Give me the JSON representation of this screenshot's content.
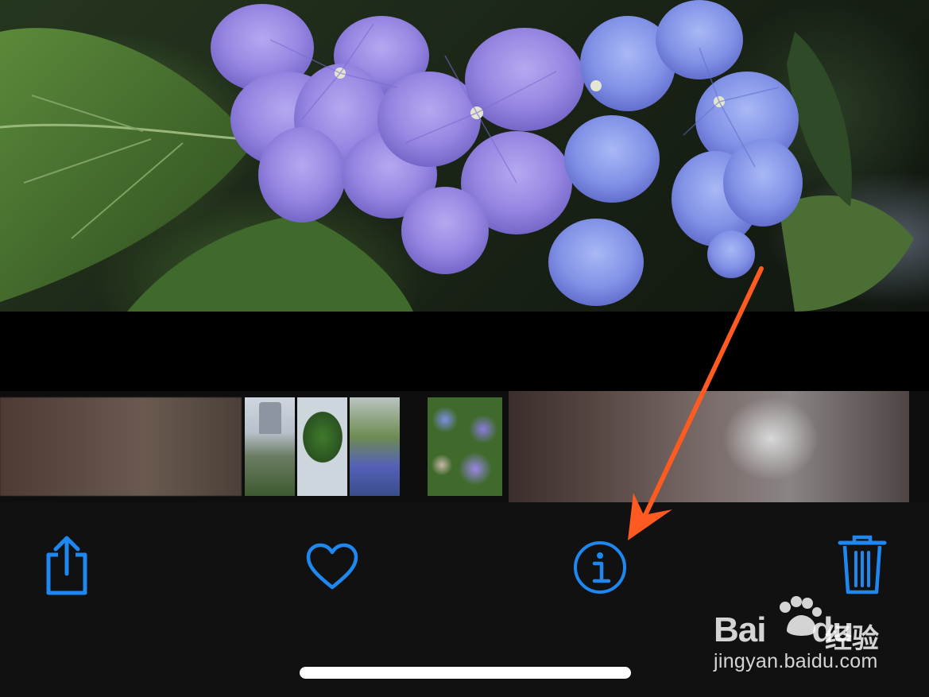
{
  "photo": {
    "subject": "hydrangea-flowers"
  },
  "filmstrip": {
    "thumbnails": [
      {
        "name": "blurred-thumbnail-1"
      },
      {
        "name": "tower-thumbnail"
      },
      {
        "name": "tree-thumbnail"
      },
      {
        "name": "hydrangea-garden-thumbnail"
      },
      {
        "name": "hydrangea-thumbnail-selected"
      },
      {
        "name": "blurred-thumbnail-2"
      }
    ]
  },
  "toolbar": {
    "share_icon": "share-icon",
    "favorite_icon": "heart-icon",
    "info_icon": "info-icon",
    "delete_icon": "trash-icon",
    "accent": "#1e88f0"
  },
  "annotation": {
    "arrow_color": "#ff5a1f"
  },
  "watermark": {
    "brand": "Bai",
    "brand2": "du",
    "cn": "经验",
    "url": "jingyan.baidu.com"
  }
}
